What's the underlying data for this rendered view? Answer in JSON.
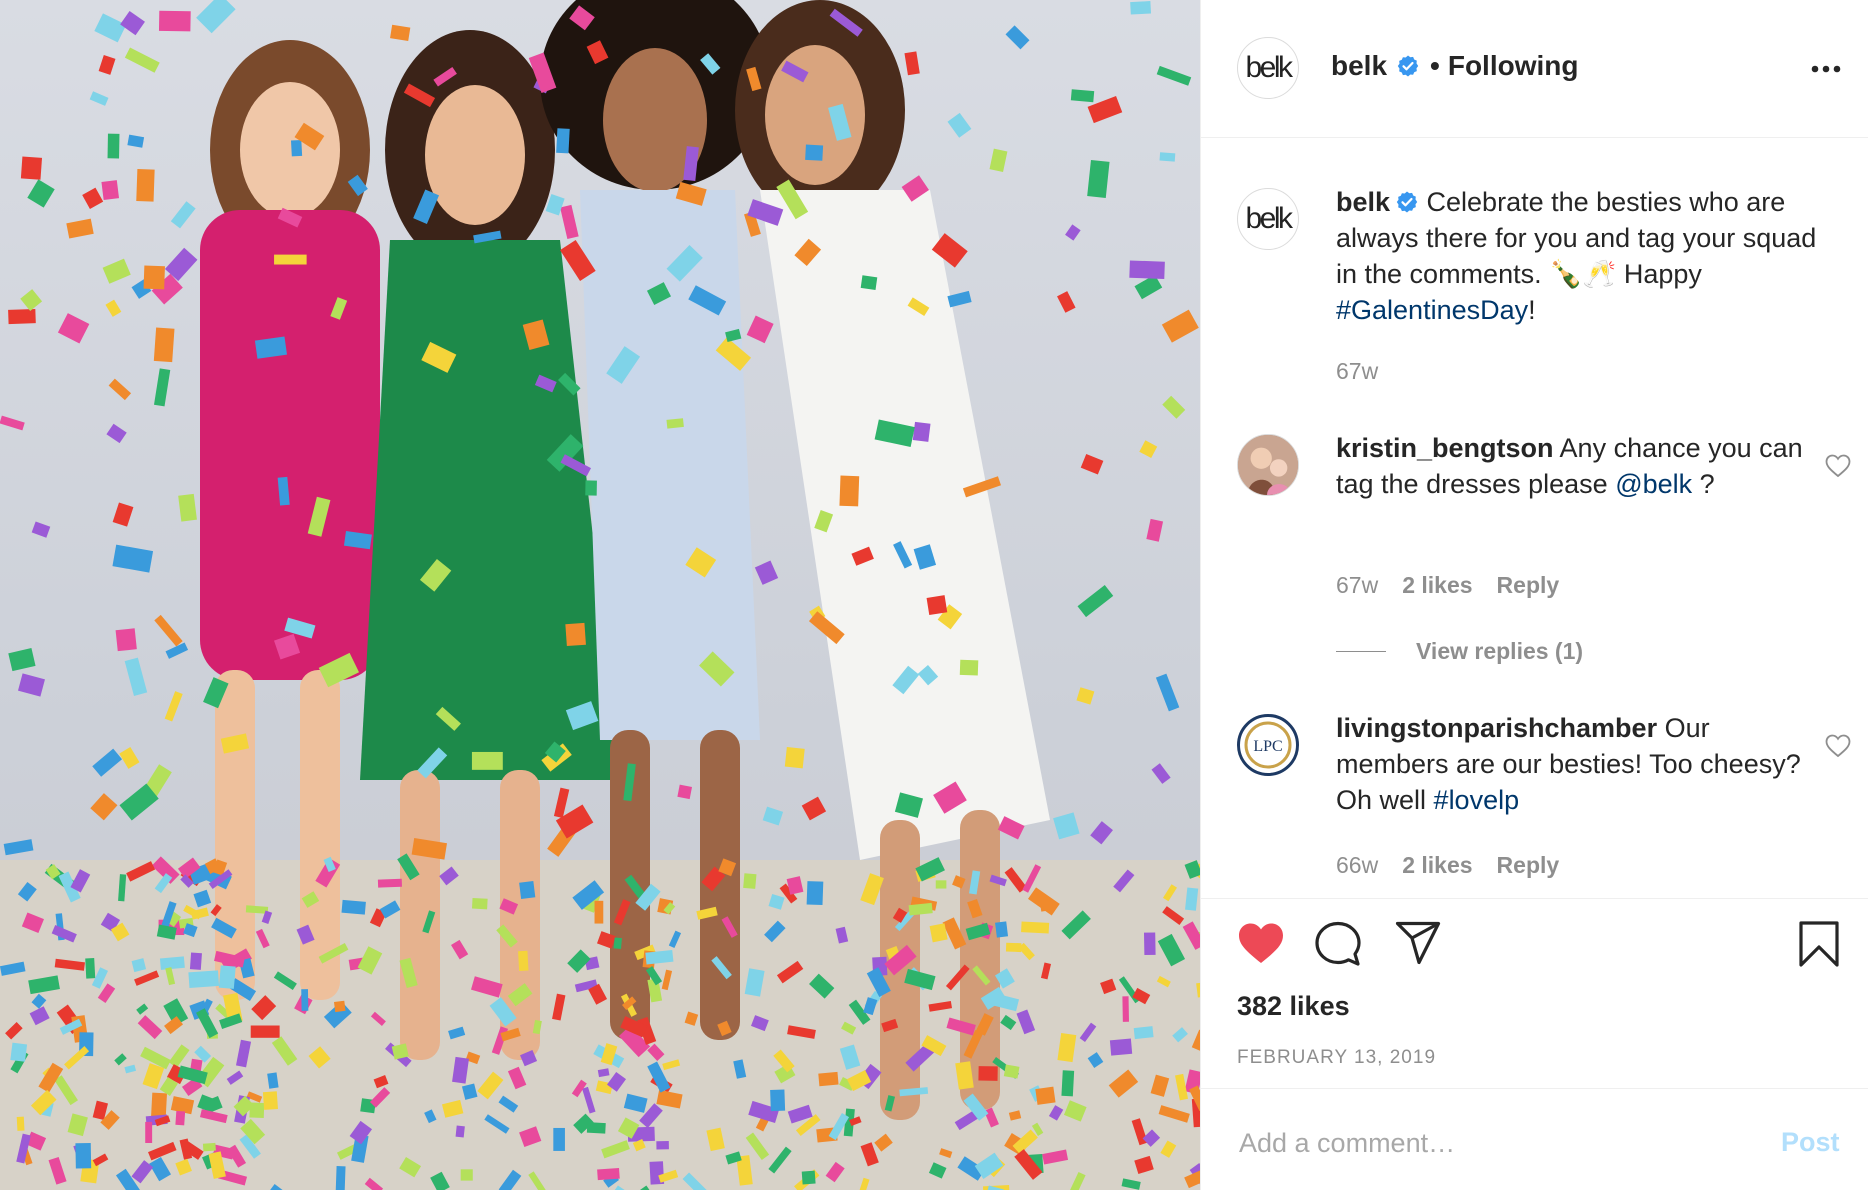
{
  "photo": {
    "alt_description": "",
    "confetti_colors": [
      "#e8392f",
      "#f4d43a",
      "#3a9bdc",
      "#2eb36b",
      "#f08a2c",
      "#e84a9c",
      "#9b5ad6",
      "#7fd3e8",
      "#b4e05a"
    ]
  },
  "header": {
    "username": "belk",
    "separator": "•",
    "follow_status": "Following",
    "avatar_logo": "belk",
    "more_icon": "more-horizontal-icon"
  },
  "caption": {
    "username": "belk",
    "text_before": " Celebrate the besties who are always there for you and tag your squad in the comments. 🍾🥂 Happy ",
    "hashtag": "#GalentinesDay",
    "text_after": "!",
    "time": "67w"
  },
  "comments": [
    {
      "username": "kristin_bengtson",
      "text": " Any chance you can tag the dresses please ",
      "mention": "@belk",
      "text_tail": " ?",
      "time": "67w",
      "likes": "2 likes",
      "reply": "Reply",
      "view_replies": "View replies (1)"
    },
    {
      "username": "livingstonparishchamber",
      "text": " Our members are our besties! Too cheesy? Oh well ",
      "hashtag": "#lovelp",
      "time": "66w",
      "likes": "2 likes",
      "reply": "Reply",
      "avatar_logo": "LPC"
    }
  ],
  "actions": {
    "like_icon": "heart-filled-icon",
    "comment_icon": "comment-bubble-icon",
    "share_icon": "paper-plane-icon",
    "save_icon": "bookmark-icon",
    "likes": "382 likes",
    "date": "FEBRUARY 13, 2019"
  },
  "add_comment": {
    "placeholder": "Add a comment…",
    "post_label": "Post"
  },
  "colors": {
    "text": "#262626",
    "muted": "#8e8e8e",
    "link": "#00376b",
    "like_red": "#ed4956",
    "verified_blue": "#3897f0",
    "post_disabled": "#b2dffc"
  }
}
